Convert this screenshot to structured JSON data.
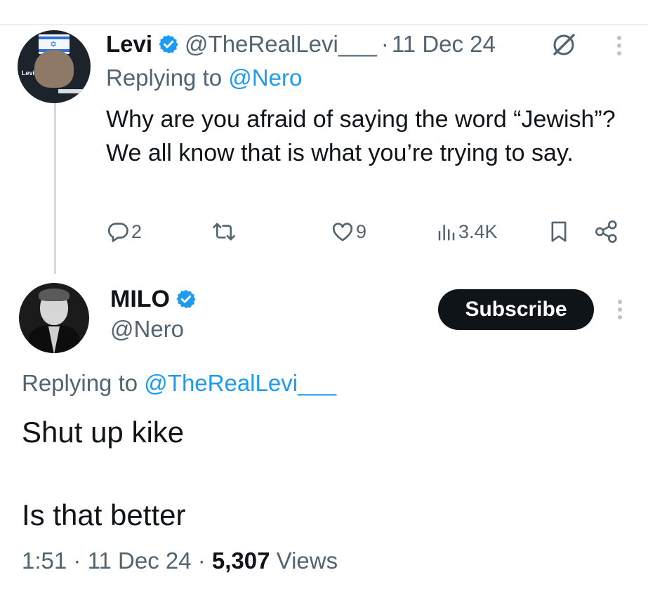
{
  "reply_tweet": {
    "author_name": "Levi",
    "handle": "@TheRealLevi___",
    "separator": "·",
    "date": "11 Dec 24",
    "replying_prefix": "Replying to",
    "replying_to": "@Nero",
    "text": "Why are you afraid of saying the word “Jewish”? We all know that is what you’re trying to say.",
    "avatar_caption": "Levi",
    "actions": {
      "replies": "2",
      "likes": "9",
      "views": "3.4K"
    }
  },
  "main_tweet": {
    "author_name": "MILO",
    "handle": "@Nero",
    "subscribe_label": "Subscribe",
    "replying_prefix": "Replying to",
    "replying_to": "@TheRealLevi___",
    "text_line1": "Shut up kike",
    "text_line2": "Is that better",
    "time": "1:51",
    "sep1": "·",
    "date": "11 Dec 24",
    "sep2": "·",
    "views_count": "5,307",
    "views_label": "Views"
  },
  "colors": {
    "accent": "#1d9bf0",
    "text": "#0f1419",
    "secondary": "#536471",
    "button_bg": "#0f1419"
  },
  "icons": [
    "verified-badge-icon",
    "grok-icon",
    "more-icon",
    "reply-icon",
    "retweet-icon",
    "like-icon",
    "views-icon",
    "bookmark-icon",
    "share-icon"
  ]
}
